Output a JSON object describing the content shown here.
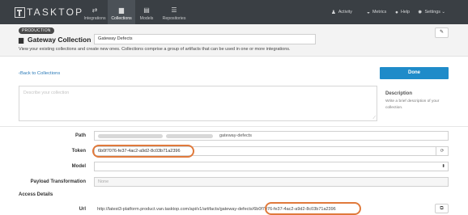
{
  "app": {
    "logo_text": "TASKTOP",
    "nav_tabs": [
      {
        "label": "Integrations",
        "icon": "swap-arrows-icon"
      },
      {
        "label": "Collections",
        "icon": "collection-icon"
      },
      {
        "label": "Models",
        "icon": "document-icon"
      },
      {
        "label": "Repositories",
        "icon": "database-icon"
      }
    ],
    "active_tab": "Collections",
    "nav_right": [
      {
        "label": "Activity",
        "icon": "bell-icon"
      },
      {
        "label": "Metrics",
        "icon": "dashboard-icon"
      },
      {
        "label": "Help",
        "icon": "help-icon"
      },
      {
        "label": "Settings ⌄",
        "icon": "gear-icon"
      }
    ]
  },
  "header": {
    "badge": "PRODUCTION",
    "title": "Gateway Collection",
    "name_value": "Gateway Defects",
    "description": "View your existing collections and create new ones. Collections comprise a group of artifacts that can be used in one or more integrations."
  },
  "actions": {
    "back_label": "Back to Collections",
    "done_label": "Done"
  },
  "description_panel": {
    "placeholder": "Describe your collection",
    "title": "Description",
    "help": "Write a brief description of your collection."
  },
  "form": {
    "path_label": "Path",
    "path_suffix": "gateway-defects",
    "token_label": "Token",
    "token_value": "6b0f7076-fe37-4ac2-a9d2-8c03b71a2396",
    "model_label": "Model",
    "model_value": "",
    "payload_label": "Payload Transformation",
    "payload_value": "None",
    "access_title": "Access Details",
    "url_label": "Url",
    "url_value": "http://latest3-platform.product.van.tasktop.com/api/v1/artifacts/gateway-defects/6b0f7076-fe37-4ac2-a9d2-8c03b71a2396"
  },
  "colors": {
    "nav_bg": "#3a3f44",
    "accent": "#1f8bc9",
    "highlight": "#e07a3c"
  }
}
